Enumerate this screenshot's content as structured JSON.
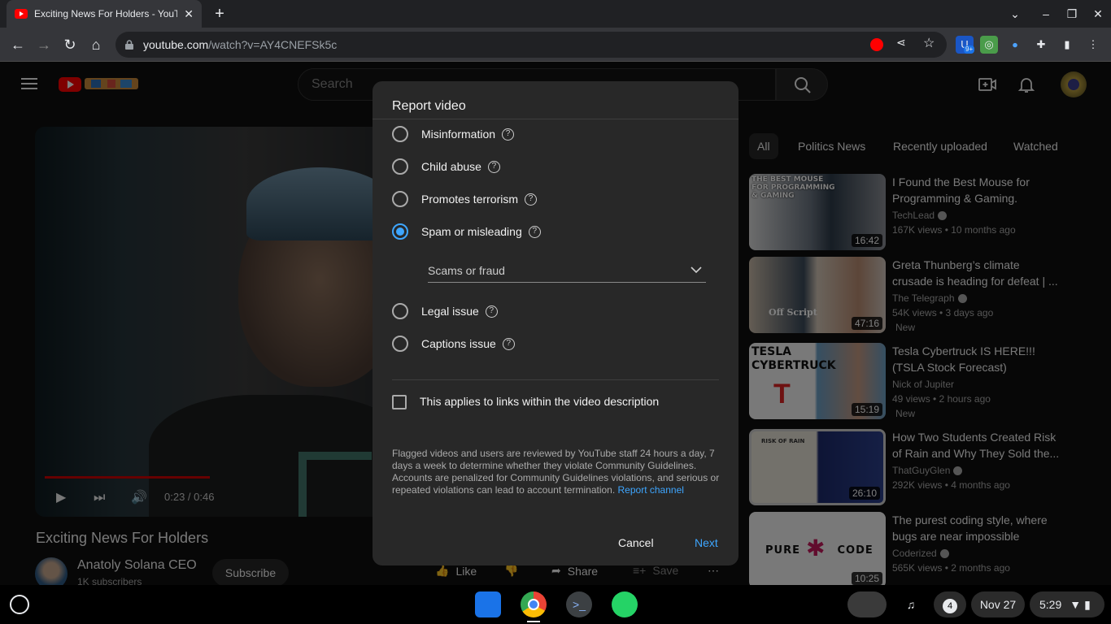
{
  "browser": {
    "tab_title": "Exciting News For Holders - YouTube",
    "url_host": "youtube.com",
    "url_path": "/watch?v=AY4CNEFSk5c",
    "extension_badge": "9+"
  },
  "youtube": {
    "search_placeholder": "Search",
    "video_title": "Exciting News For Holders",
    "channel_name": "Anatoly Solana CEO",
    "channel_subs": "1K subscribers",
    "subscribe_label": "Subscribe",
    "player_time": "0:23 / 0:46",
    "player_progress": 0.5,
    "actions": {
      "like": "Like",
      "share": "Share",
      "save": "Save"
    },
    "chips": [
      "All",
      "Politics News",
      "Recently uploaded",
      "Watched"
    ],
    "recommendations": [
      {
        "title": "I Found the Best Mouse for Programming & Gaming.",
        "channel": "TechLead",
        "meta": "167K views • 10 months ago",
        "duration": "16:42",
        "new": "",
        "thumb_text": "THE BEST MOUSE\nFOR PROGRAMMING\n& GAMING"
      },
      {
        "title": "Greta Thunberg’s climate crusade is heading for defeat | ...",
        "channel": "The Telegraph",
        "meta": "54K views • 3 days ago",
        "duration": "47:16",
        "new": "New",
        "thumb_text": "Off Script"
      },
      {
        "title": "Tesla Cybertruck IS HERE!!! (TSLA Stock Forecast)",
        "channel": "Nick of Jupiter",
        "meta": "49 views • 2 hours ago",
        "duration": "15:19",
        "new": "New",
        "thumb_text": "TESLA\nCYBERTRUCK"
      },
      {
        "title": "How Two Students Created Risk of Rain and Why They Sold the...",
        "channel": "ThatGuyGlen",
        "meta": "292K views • 4 months ago",
        "duration": "26:10",
        "new": "",
        "thumb_text": "RISK OF RAIN"
      },
      {
        "title": "The purest coding style, where bugs are near impossible",
        "channel": "Coderized",
        "meta": "565K views • 2 months ago",
        "duration": "10:25",
        "new": "",
        "thumb_text": "PURE CODE"
      }
    ]
  },
  "dialog": {
    "title": "Report video",
    "options": [
      {
        "label": "Misinformation",
        "checked": false
      },
      {
        "label": "Child abuse",
        "checked": false
      },
      {
        "label": "Promotes terrorism",
        "checked": false
      },
      {
        "label": "Spam or misleading",
        "checked": true
      },
      {
        "label": "Legal issue",
        "checked": false
      },
      {
        "label": "Captions issue",
        "checked": false
      }
    ],
    "sub_select_value": "Scams or fraud",
    "checkbox_label": "This applies to links within the video description",
    "notice": "Flagged videos and users are reviewed by YouTube staff 24 hours a day, 7 days a week to determine whether they violate Community Guidelines. Accounts are penalized for Community Guidelines violations, and serious or repeated violations can lead to account termination.",
    "notice_link": "Report channel",
    "cancel_label": "Cancel",
    "next_label": "Next"
  },
  "shelf": {
    "notification_count": "4",
    "date": "Nov 27",
    "time": "5:29"
  },
  "colors": {
    "accent": "#3ea6ff",
    "yt_red": "#ff0000",
    "progress": "#cc0000"
  }
}
